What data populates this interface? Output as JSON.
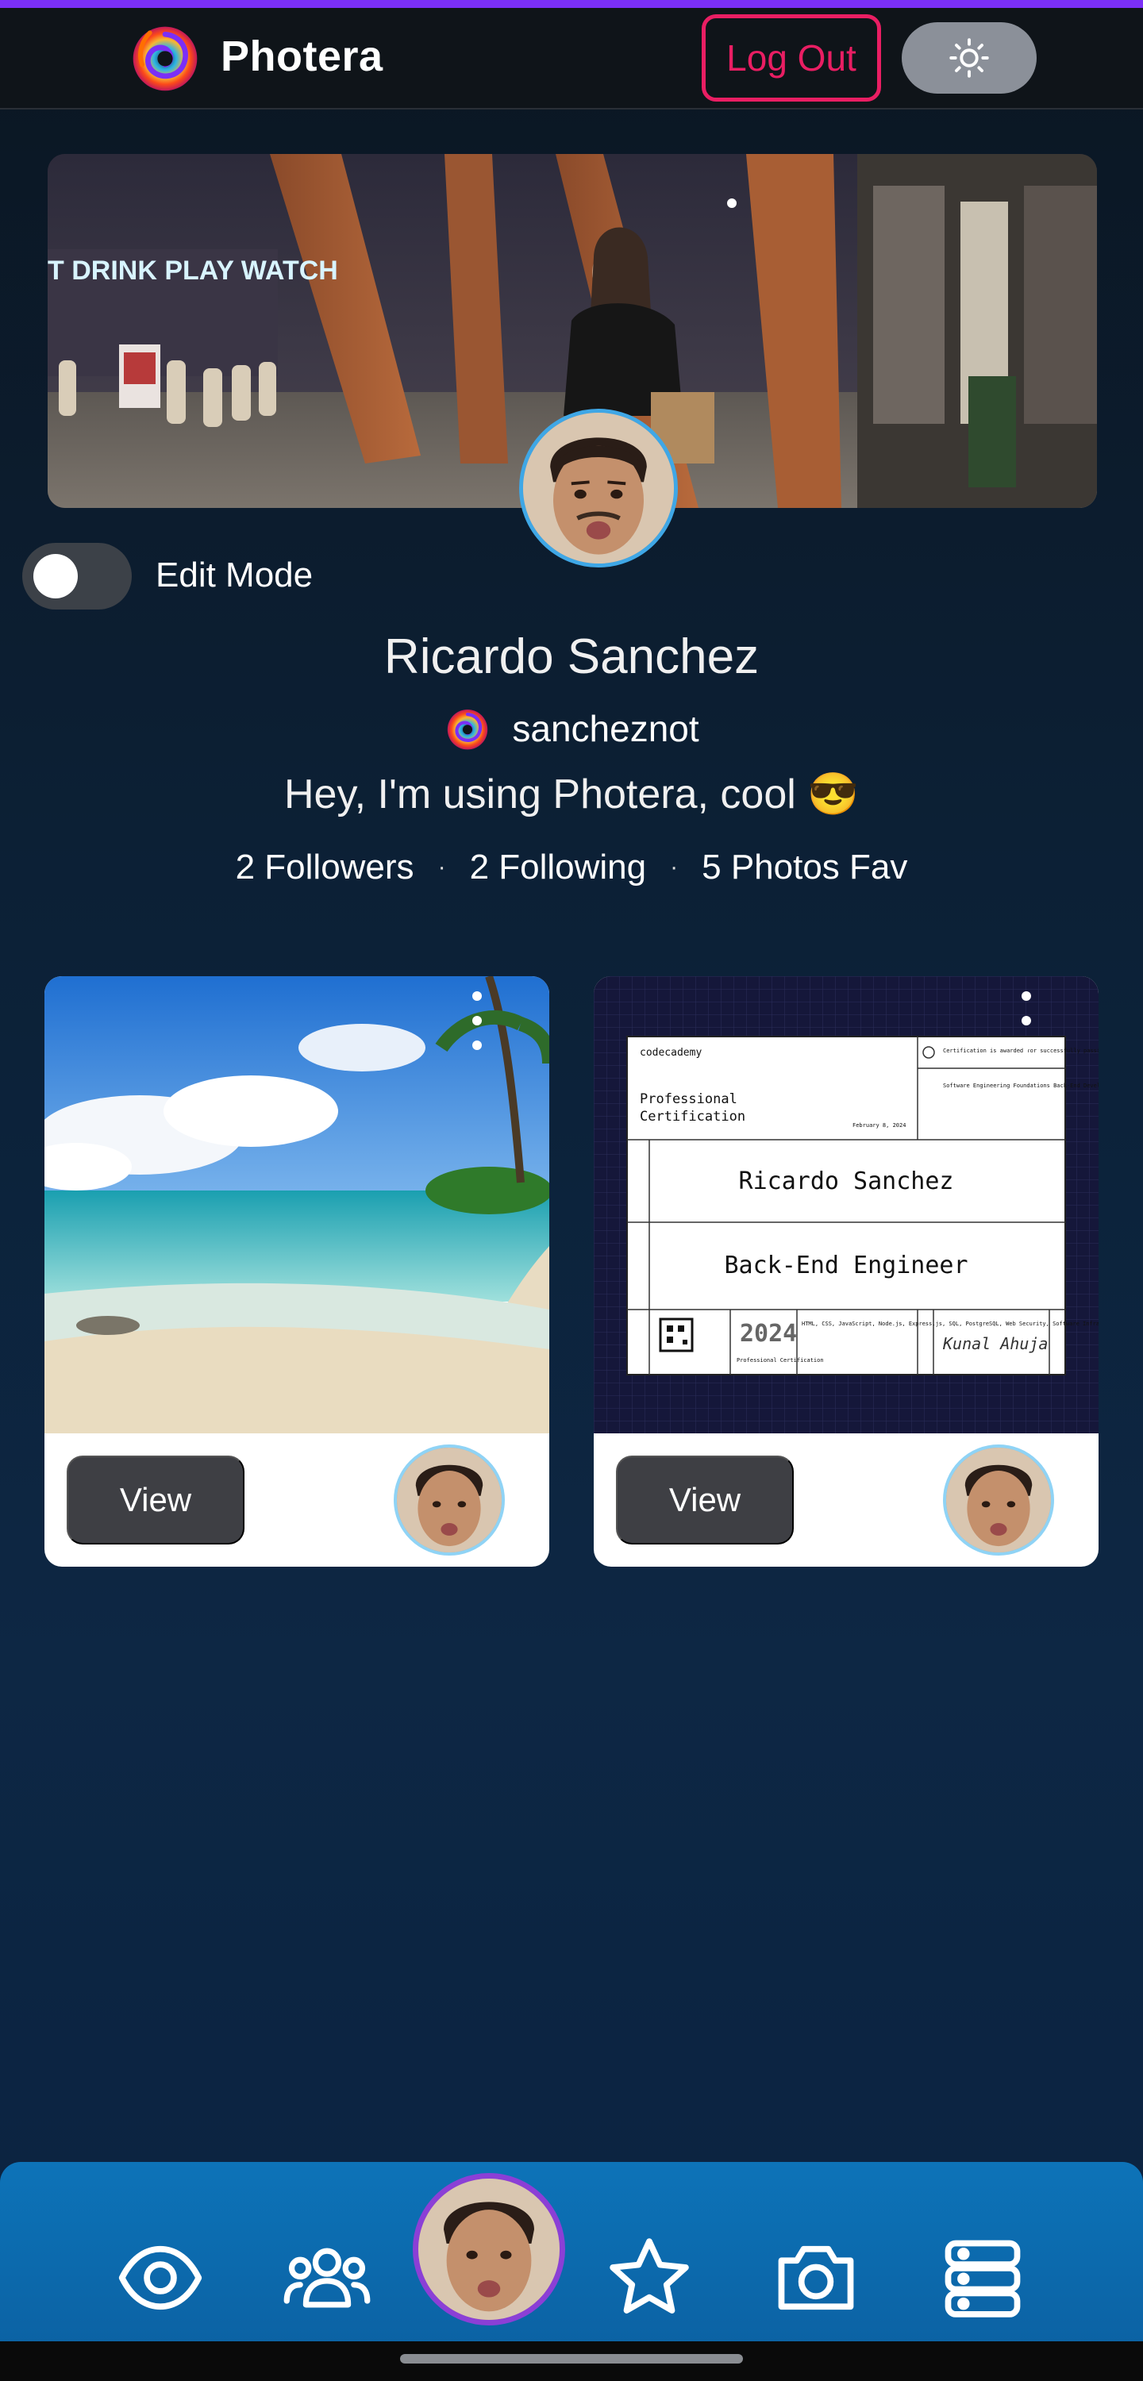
{
  "header": {
    "brand": "Photera",
    "logout_label": "Log Out",
    "theme_icon": "sun-icon"
  },
  "cover": {
    "sign_text": "T DRINK PLAY WATCH"
  },
  "edit_mode": {
    "label": "Edit Mode",
    "enabled": false
  },
  "profile": {
    "name": "Ricardo Sanchez",
    "handle": "sancheznot",
    "bio": "Hey, I'm using Photera, cool 😎",
    "followers": "2 Followers",
    "following": "2 Following",
    "photos_fav": "5 Photos Fav",
    "separator": "·"
  },
  "cards": [
    {
      "view_label": "View",
      "image": "beach-photo"
    },
    {
      "view_label": "View",
      "image": "certificate-photo",
      "certificate": {
        "provider": "codecademy",
        "title_line1": "Professional",
        "title_line2": "Certification",
        "date": "February 8, 2024",
        "awarded_note": "Certification is awarded for successfully passing all exams",
        "skills_note": "Software Engineering Foundations Back-End Development Advanced Back-End Development Security, Infrastructure, & Scalability",
        "name": "Ricardo Sanchez",
        "role": "Back-End Engineer",
        "year": "2024",
        "year_caption": "Professional Certification",
        "tech": "HTML, CSS, JavaScript, Node.js, Express.js, SQL, PostgreSQL, Web Security, Software Infrastructure & Scalability, Data Structures, Algorithms",
        "signature": "Kunal Ahuja"
      }
    }
  ],
  "bottom_nav": {
    "items": [
      "eye-icon",
      "community-icon",
      "profile-avatar",
      "star-icon",
      "camera-icon",
      "server-icon"
    ]
  },
  "colors": {
    "accent_pink": "#e91e63",
    "nav_blue": "#0d73b8",
    "avatar_ring": "#8b3fd6",
    "top_stripe": "#7b2ff7"
  }
}
